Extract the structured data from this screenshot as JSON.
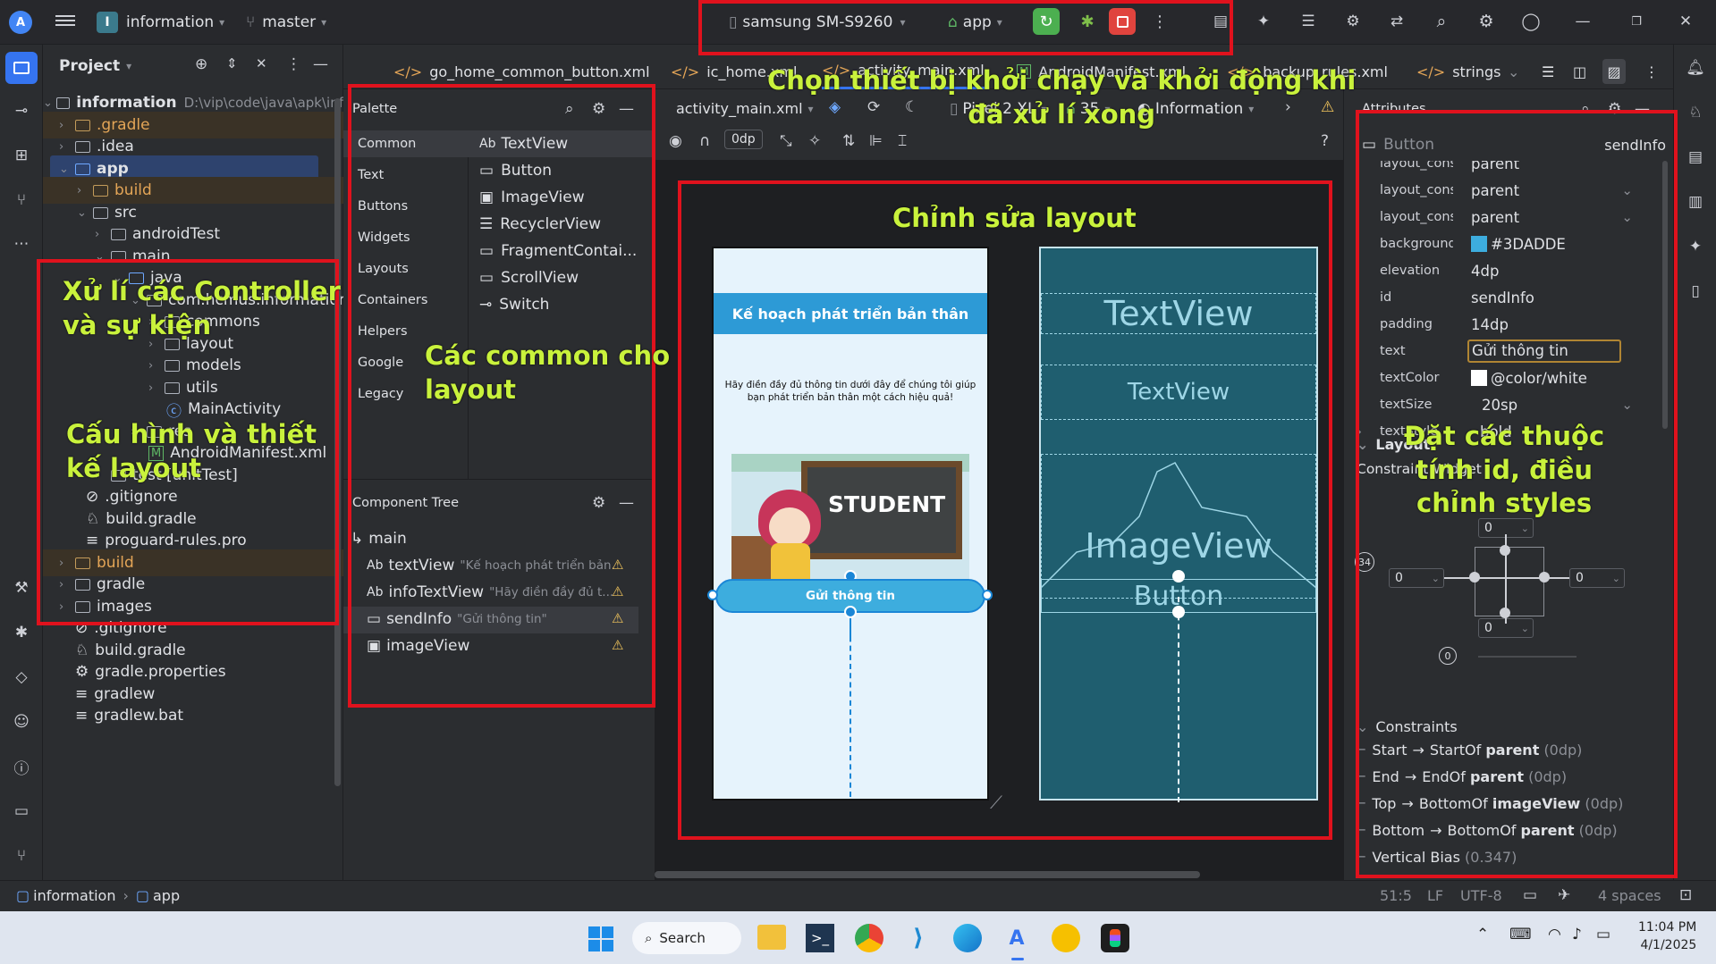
{
  "topbar": {
    "project_name": "information",
    "project_letter": "I",
    "branch": "master",
    "device": "samsung SM-S9260",
    "run_config": "app",
    "window_controls": [
      "minimize",
      "restore",
      "close"
    ]
  },
  "tabs": [
    {
      "label": "go_home_common_button.xml"
    },
    {
      "label": "ic_home.xml"
    },
    {
      "label": "activity_main.xml"
    },
    {
      "label": "AndroidManifest.xml"
    },
    {
      "label": "backup_rules.xml"
    },
    {
      "label": "strings"
    }
  ],
  "project": {
    "title": "Project",
    "root": "information",
    "root_path": "D:\\vip\\code\\java\\apk\\inf",
    "nodes": [
      ".gradle",
      ".idea",
      "app",
      "build",
      "src",
      "androidTest",
      "main",
      "java",
      "com.hcmus.information",
      "commons",
      "layout",
      "models",
      "utils",
      "MainActivity",
      "res",
      "AndroidManifest.xml",
      "test [unitTest]",
      ".gitignore",
      "build.gradle",
      "proguard-rules.pro",
      "build",
      "gradle",
      "images",
      ".gitignore",
      "build.gradle",
      "gradle.properties",
      "gradlew",
      "gradlew.bat"
    ]
  },
  "palette": {
    "title": "Palette",
    "categories": [
      "Common",
      "Text",
      "Buttons",
      "Widgets",
      "Layouts",
      "Containers",
      "Helpers",
      "Google",
      "Legacy"
    ],
    "items": [
      "TextView",
      "Button",
      "ImageView",
      "RecyclerView",
      "FragmentContai...",
      "ScrollView",
      "Switch"
    ]
  },
  "component_tree": {
    "title": "Component Tree",
    "root": "main",
    "items": [
      {
        "name": "textView",
        "hint": "\"Kế hoạch phát triển bản..."
      },
      {
        "name": "infoTextView",
        "hint": "\"Hãy điền đầy đủ t..."
      },
      {
        "name": "sendInfo",
        "hint": "\"Gửi thông tin\""
      },
      {
        "name": "imageView",
        "hint": ""
      }
    ]
  },
  "design_toolbar": {
    "file": "activity_main.xml",
    "device": "Pixel 2 XL",
    "api": "35",
    "theme": "Information",
    "margin": "0dp"
  },
  "phone": {
    "header": "Kế hoạch phát triển bản thân",
    "info": "Hãy điền đầy đủ thông tin dưới đây để chúng tôi giúp bạn phát triển bản thân một cách hiệu quả!",
    "board_text": "STUDENT",
    "button": "Gửi thông tin"
  },
  "blueprint": {
    "textview1": "TextView",
    "textview2": "TextView",
    "imageview": "ImageView",
    "button": "Button"
  },
  "attributes": {
    "title": "Attributes",
    "widget": "Button",
    "widget_id": "sendInfo",
    "rows": [
      {
        "k": "layout_constrain...",
        "v": "parent"
      },
      {
        "k": "layout_constrain...",
        "v": "parent"
      },
      {
        "k": "backgroundTint",
        "v": "#3DADDE"
      },
      {
        "k": "elevation",
        "v": "4dp"
      },
      {
        "k": "id",
        "v": "sendInfo"
      },
      {
        "k": "padding",
        "v": "14dp"
      },
      {
        "k": "text",
        "v": "Gửi thông tin"
      },
      {
        "k": "textColor",
        "v": "@color/white"
      },
      {
        "k": "textSize",
        "v": "20sp"
      },
      {
        "k": "textStyle",
        "v": "bold"
      }
    ],
    "layout_section": "Layout",
    "constraint_widget": "Constraint Widget",
    "margins": {
      "top": "0",
      "left": "0",
      "right": "0",
      "bottom": "0"
    },
    "bias_label": "34",
    "bias_small": "0",
    "constraints_title": "Constraints",
    "constraints": [
      {
        "a": "Start",
        "b": "StartOf",
        "c": "parent",
        "d": "(0dp)"
      },
      {
        "a": "End",
        "b": "EndOf",
        "c": "parent",
        "d": "(0dp)"
      },
      {
        "a": "Top",
        "b": "BottomOf",
        "c": "imageView",
        "d": "(0dp)"
      },
      {
        "a": "Bottom",
        "b": "BottomOf",
        "c": "parent",
        "d": "(0dp)"
      }
    ],
    "vertical_bias": "Vertical Bias",
    "vertical_bias_value": "(0.347)"
  },
  "annotations": {
    "device_note": "Chọn thiết bị khởi chạy và khởi động khi\nđã xử lí xong",
    "controller_note": "Xử lí các Controller\nvà sự kiện",
    "layout_config_note": "Cấu hình và thiết\nkế layout",
    "common_note": "Các common cho\nlayout",
    "edit_layout_note": "Chỉnh sửa layout",
    "attributes_note": "Đặt các thuộc\ntính id, điều\nchỉnh styles"
  },
  "statusbar": {
    "crumb1": "information",
    "crumb2": "app",
    "position": "51:5",
    "line_sep": "LF",
    "encoding": "UTF-8",
    "indent": "4 spaces"
  },
  "taskbar": {
    "search": "Search",
    "time": "11:04 PM",
    "date": "4/1/2025"
  },
  "colors": {
    "accent": "#3DADDE",
    "red": "#e0121d",
    "annotation": "#c9f23c"
  }
}
